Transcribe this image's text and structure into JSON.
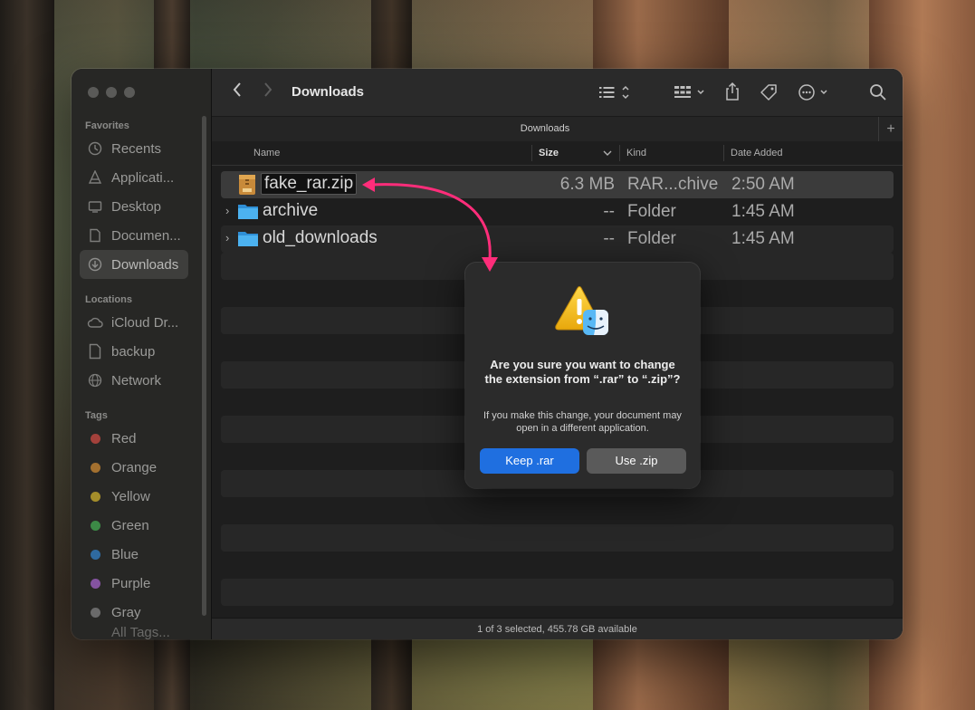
{
  "window": {
    "title": "Downloads",
    "tab_label": "Downloads"
  },
  "sidebar": {
    "favorites_label": "Favorites",
    "favorites": [
      {
        "label": "Recents",
        "icon": "clock-icon"
      },
      {
        "label": "Applicati...",
        "icon": "applications-icon"
      },
      {
        "label": "Desktop",
        "icon": "desktop-icon"
      },
      {
        "label": "Documen...",
        "icon": "document-icon"
      },
      {
        "label": "Downloads",
        "icon": "download-icon",
        "active": true
      }
    ],
    "locations_label": "Locations",
    "locations": [
      {
        "label": "iCloud Dr...",
        "icon": "cloud-icon"
      },
      {
        "label": "backup",
        "icon": "file-icon"
      },
      {
        "label": "Network",
        "icon": "globe-icon"
      }
    ],
    "tags_label": "Tags",
    "tags": [
      {
        "label": "Red",
        "color": "#a3413b"
      },
      {
        "label": "Orange",
        "color": "#a3702f"
      },
      {
        "label": "Yellow",
        "color": "#a48d2a"
      },
      {
        "label": "Green",
        "color": "#3c8a46"
      },
      {
        "label": "Blue",
        "color": "#2f6aa0"
      },
      {
        "label": "Purple",
        "color": "#8453a0"
      },
      {
        "label": "Gray",
        "color": "#6a6a6a"
      },
      {
        "label": "All Tags..."
      }
    ]
  },
  "columns": {
    "name": "Name",
    "size": "Size",
    "kind": "Kind",
    "date": "Date Added"
  },
  "files": [
    {
      "name": "fake_rar.zip",
      "size": "6.3 MB",
      "kind": "RAR...chive",
      "date": "2:50 AM",
      "type": "archive",
      "selected": true
    },
    {
      "name": "archive",
      "size": "--",
      "kind": "Folder",
      "date": "1:45 AM",
      "type": "folder"
    },
    {
      "name": "old_downloads",
      "size": "--",
      "kind": "Folder",
      "date": "1:45 AM",
      "type": "folder"
    }
  ],
  "status": "1 of 3 selected, 455.78 GB available",
  "dialog": {
    "title": "Are you sure you want to change the extension from “.rar” to “.zip”?",
    "message": "If you make this change, your document may open in a different application.",
    "keep_button": "Keep .rar",
    "use_button": "Use .zip"
  },
  "colors": {
    "accent": "#1f6fe0",
    "annotation_arrow": "#ff2d7a",
    "folder": "#3aa6e8"
  }
}
